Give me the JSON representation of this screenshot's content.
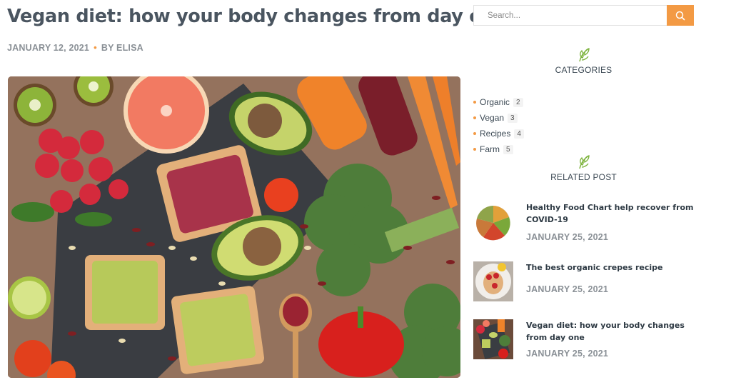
{
  "post": {
    "title": "Vegan diet: how your body changes from day one",
    "date": "JANUARY 12, 2021",
    "author": "BY ELISA",
    "image_alt": "Colorful vegan ingredients on a wooden table"
  },
  "search": {
    "placeholder": "Search...",
    "button_icon": "search-icon"
  },
  "categories": {
    "title": "CATEGORIES",
    "icon": "leaf-icon",
    "items": [
      {
        "label": "Organic",
        "count": "2"
      },
      {
        "label": "Vegan",
        "count": "3"
      },
      {
        "label": "Recipes",
        "count": "4"
      },
      {
        "label": "Farm",
        "count": "5"
      }
    ]
  },
  "related": {
    "title": "RELATED POST",
    "icon": "leaf-icon",
    "items": [
      {
        "title": "Healthy Food Chart help recover from COVID-19",
        "date": "JANUARY 25, 2021"
      },
      {
        "title": "The best organic crepes recipe",
        "date": "JANUARY 25, 2021"
      },
      {
        "title": "Vegan diet: how your body changes from day one",
        "date": "JANUARY 25, 2021"
      }
    ]
  },
  "colors": {
    "accent": "#f39a44",
    "leaf": "#7bb23a",
    "title": "#4a5560",
    "meta": "#8a9096"
  }
}
